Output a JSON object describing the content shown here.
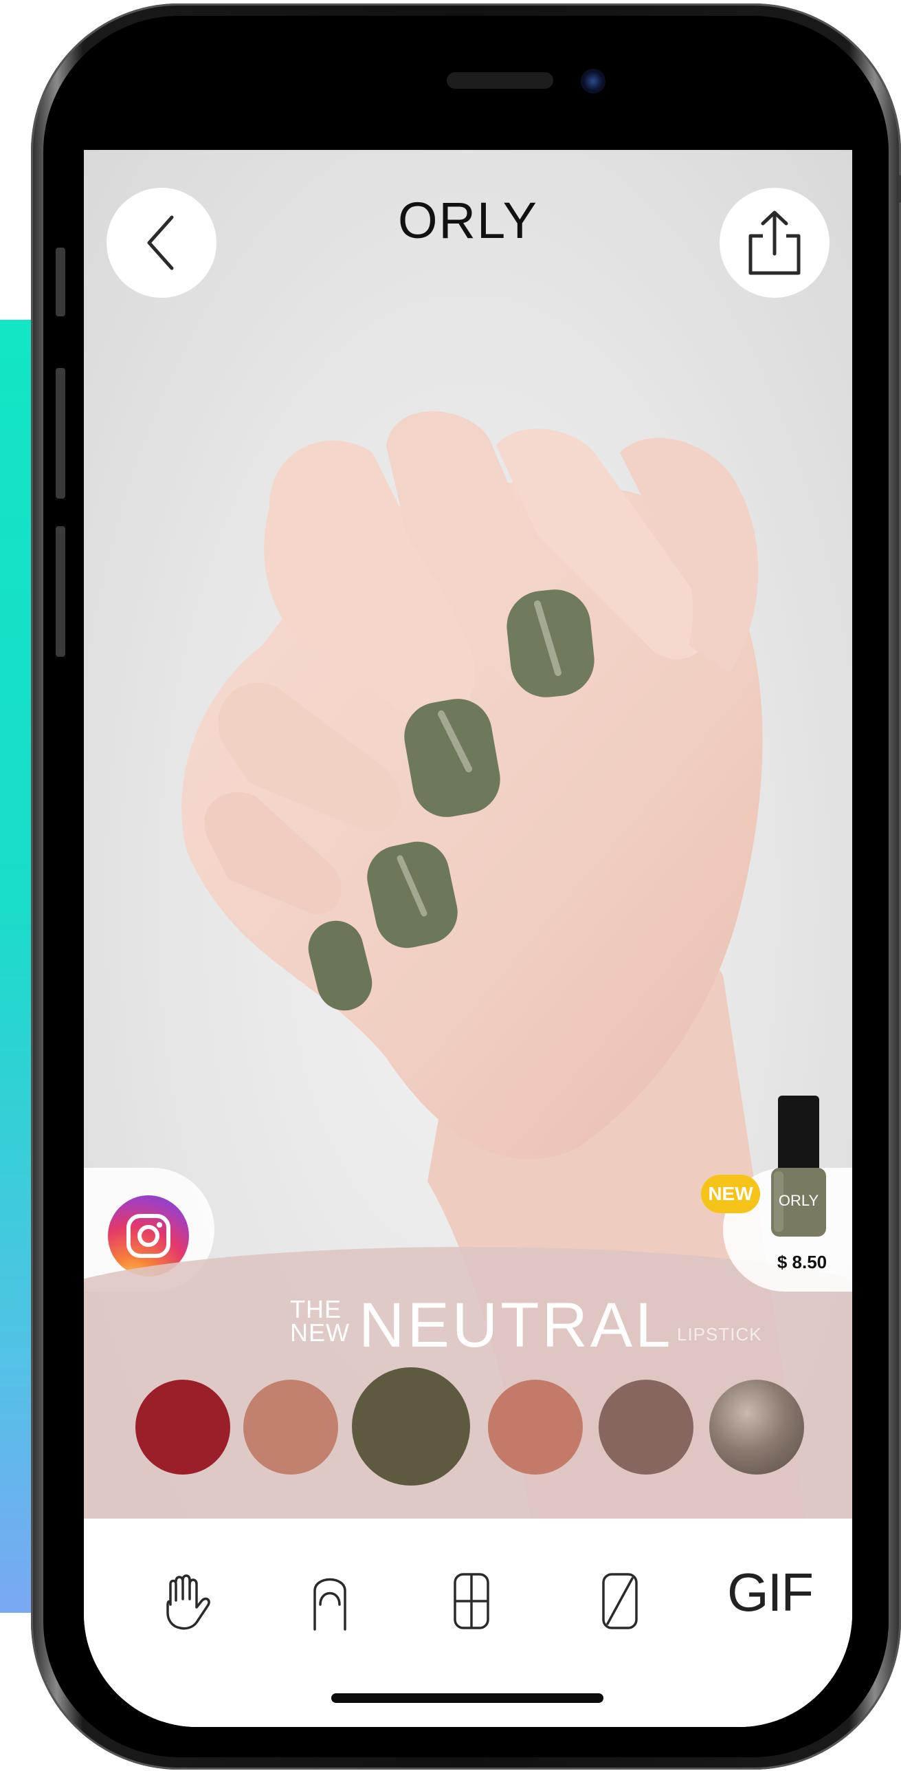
{
  "header": {
    "brand": "ORLY",
    "back_icon": "chevron-left-icon",
    "share_icon": "share-icon"
  },
  "social": {
    "icon": "instagram-icon"
  },
  "product": {
    "badge": "NEW",
    "price": "$ 8.50",
    "bottle_label": "ORLY",
    "bottle_color": "#7a7a62"
  },
  "collection": {
    "title_prefix_line1": "THE",
    "title_prefix_line2": "NEW",
    "title_main": "NEUTRAL",
    "subtitle": "LIPSTICK"
  },
  "swatches": [
    {
      "color": "#9b1f28",
      "selected": false
    },
    {
      "color": "#c2806e",
      "selected": false
    },
    {
      "color": "#5e5a3f",
      "selected": true
    },
    {
      "color": "#c47a68",
      "selected": false
    },
    {
      "color": "#86665e",
      "selected": false
    },
    {
      "color": "#8a7a70",
      "selected": false,
      "texture": "glitter"
    }
  ],
  "toolbar": {
    "tools": [
      "hand-icon",
      "nail-shape-icon",
      "grid-icon",
      "nail-length-icon"
    ],
    "gif_label": "GIF"
  },
  "colors": {
    "nail_polish": "#707a5c",
    "accent_teal": "#12e6c4"
  }
}
